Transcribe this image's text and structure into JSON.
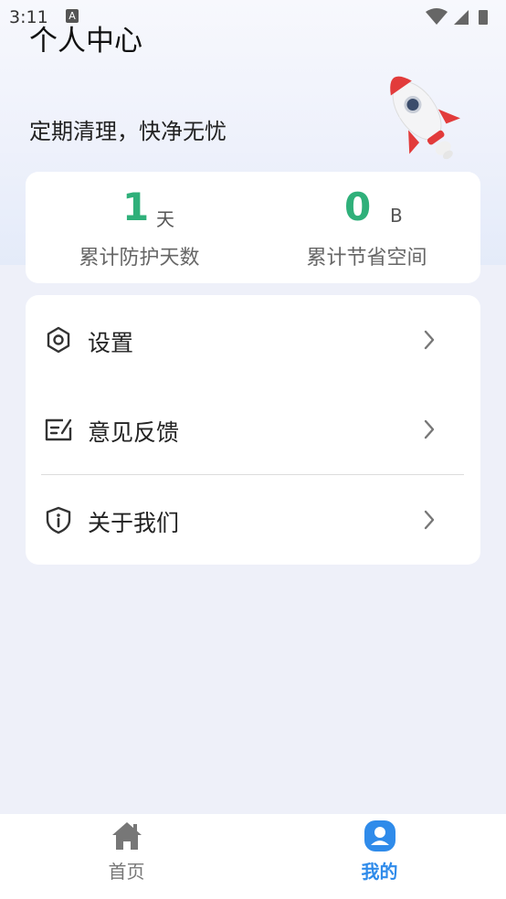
{
  "status_bar": {
    "time": "3:11",
    "notification_badge": "A"
  },
  "header": {
    "title": "个人中心",
    "slogan": "定期清理，快净无忧"
  },
  "stats": [
    {
      "value": "1",
      "unit": "天",
      "label": "累计防护天数"
    },
    {
      "value": "0",
      "unit": "B",
      "label": "累计节省空间"
    }
  ],
  "menu": {
    "items": [
      {
        "label": "设置",
        "icon": "gear-icon"
      },
      {
        "label": "意见反馈",
        "icon": "feedback-icon"
      },
      {
        "label": "关于我们",
        "icon": "info-shield-icon"
      }
    ]
  },
  "bottom_nav": {
    "items": [
      {
        "label": "首页",
        "icon": "home-icon"
      },
      {
        "label": "我的",
        "icon": "user-icon",
        "active": true
      }
    ]
  },
  "colors": {
    "accent_green": "#2fb07a",
    "accent_blue": "#2f8bea",
    "background": "#eef0f9"
  }
}
